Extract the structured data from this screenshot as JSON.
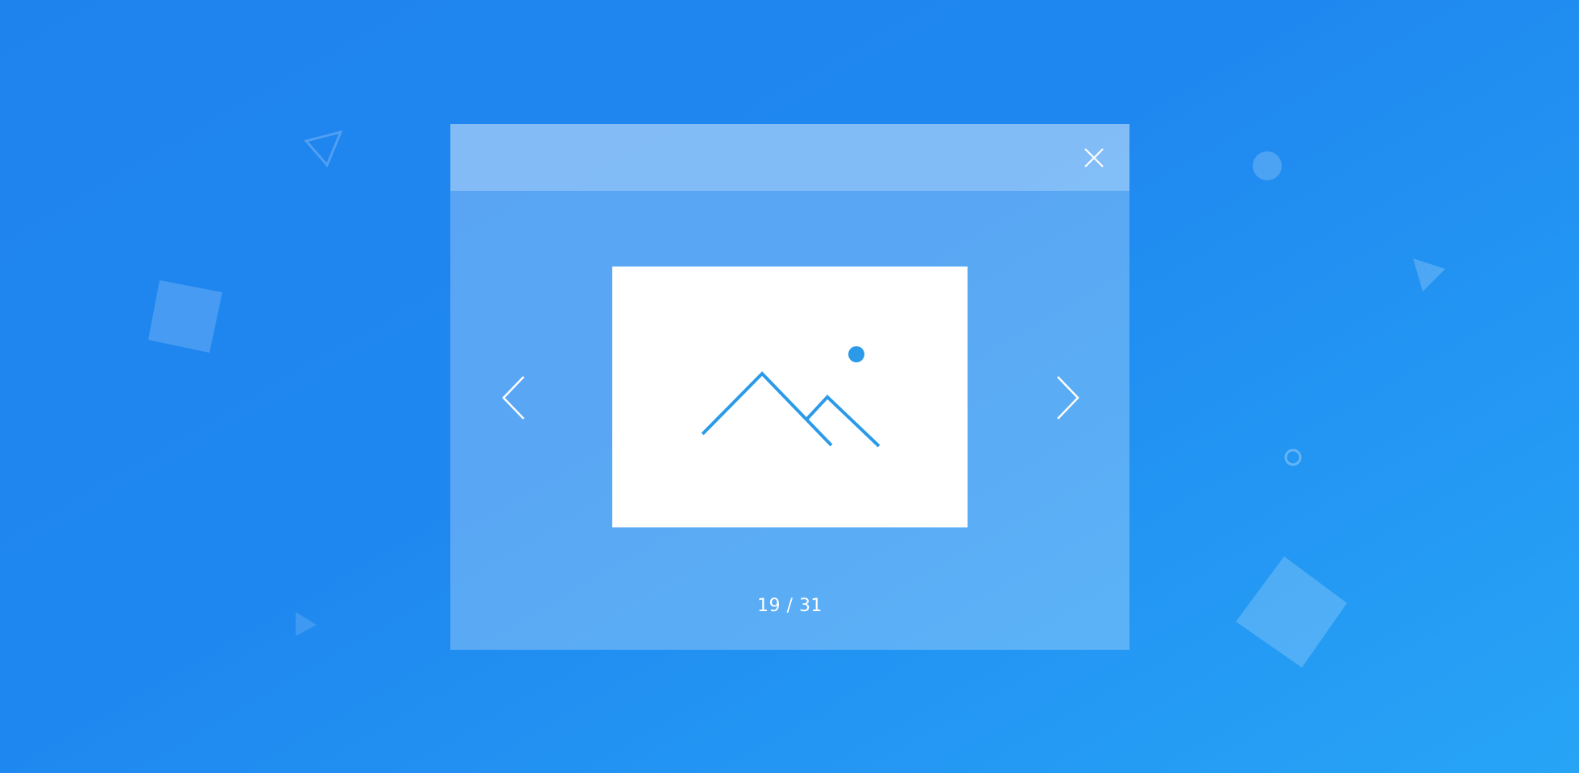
{
  "lightbox": {
    "close_icon": "close-icon",
    "prev_icon": "chevron-left-icon",
    "next_icon": "chevron-right-icon",
    "image_icon": "image-placeholder-icon",
    "counter": {
      "current": 19,
      "total": 31,
      "label": "19 / 31"
    }
  },
  "colors": {
    "background_start": "#1f83ee",
    "background_end": "#27a4f6",
    "accent": "#2b9ae8",
    "icon_white": "#ffffff"
  }
}
